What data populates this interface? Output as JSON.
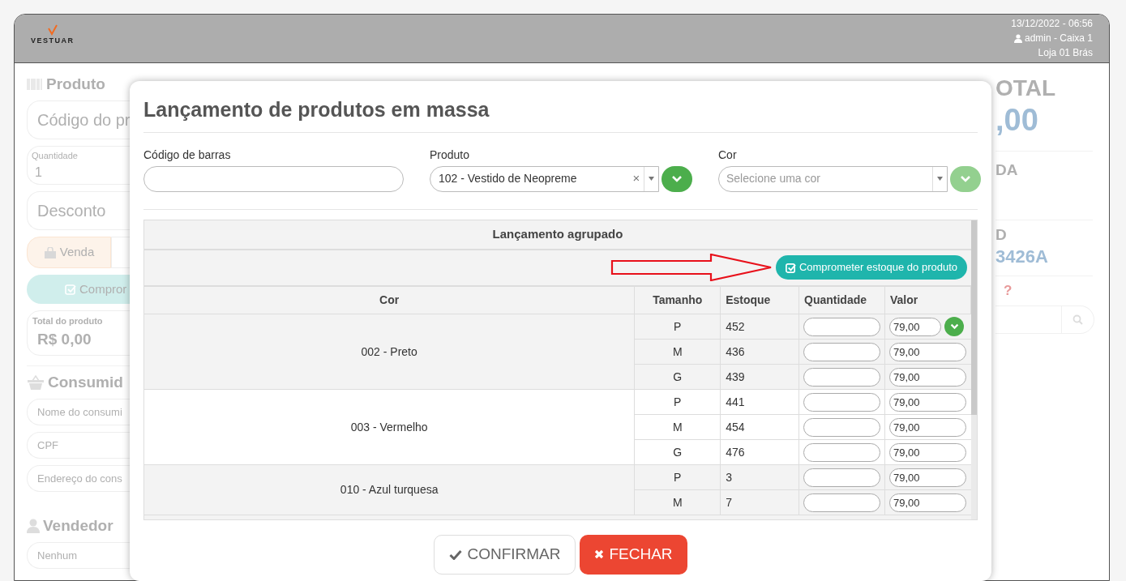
{
  "header": {
    "logo_text": "VESTUAR",
    "datetime": "13/12/2022 - 06:56",
    "user": "admin - Caixa 1",
    "store": "Loja 01 Brás"
  },
  "background_left": {
    "product_title": "Produto",
    "code_placeholder": "Código do pr",
    "quantity_label": "Quantidade",
    "quantity_value": "1",
    "discount_placeholder": "Desconto",
    "sale_tab": "Venda",
    "commit_button": "Compror",
    "total_label": "Total do produto",
    "total_value": "R$ 0,00",
    "consumer_title": "Consumid",
    "consumer_fields": [
      "Nome do consumi",
      "CPF",
      "Endereço do cons"
    ],
    "seller_title": "Vendedor",
    "seller_field": "Nenhum"
  },
  "background_right": {
    "total_title": "OTAL",
    "total_value": ",00",
    "section_2": "DA",
    "section_3": "D",
    "code": "3426A",
    "help": "?"
  },
  "modal": {
    "title": "Lançamento de produtos em massa",
    "barcode": {
      "label": "Código de barras"
    },
    "product": {
      "label": "Produto",
      "value": "102 - Vestido de Neopreme",
      "clear": "×",
      "button_disabled": false
    },
    "color": {
      "label": "Cor",
      "placeholder": "Selecione uma cor",
      "button_disabled": true
    },
    "table": {
      "title": "Lançamento agrupado",
      "commit_button": "Comprometer estoque do produto",
      "columns": [
        "Cor",
        "Tamanho",
        "Estoque",
        "Quantidade",
        "Valor"
      ],
      "groups": [
        {
          "color_name": "002 - Preto",
          "rows": [
            {
              "size": "P",
              "stock": "452",
              "quantity": "",
              "value": "79,00",
              "confirm_button": true
            },
            {
              "size": "M",
              "stock": "436",
              "quantity": "",
              "value": "79,00",
              "confirm_button": false
            },
            {
              "size": "G",
              "stock": "439",
              "quantity": "",
              "value": "79,00",
              "confirm_button": false
            }
          ]
        },
        {
          "color_name": "003 - Vermelho",
          "rows": [
            {
              "size": "P",
              "stock": "441",
              "quantity": "",
              "value": "79,00",
              "confirm_button": false
            },
            {
              "size": "M",
              "stock": "454",
              "quantity": "",
              "value": "79,00",
              "confirm_button": false
            },
            {
              "size": "G",
              "stock": "476",
              "quantity": "",
              "value": "79,00",
              "confirm_button": false
            }
          ]
        },
        {
          "color_name": "010 - Azul turquesa",
          "rows": [
            {
              "size": "P",
              "stock": "3",
              "quantity": "",
              "value": "79,00",
              "confirm_button": false
            },
            {
              "size": "M",
              "stock": "7",
              "quantity": "",
              "value": "79,00",
              "confirm_button": false
            }
          ]
        }
      ]
    },
    "buttons": [
      {
        "kind": "confirm",
        "label": "CONFIRMAR"
      },
      {
        "kind": "close",
        "label": "FECHAR"
      }
    ]
  }
}
